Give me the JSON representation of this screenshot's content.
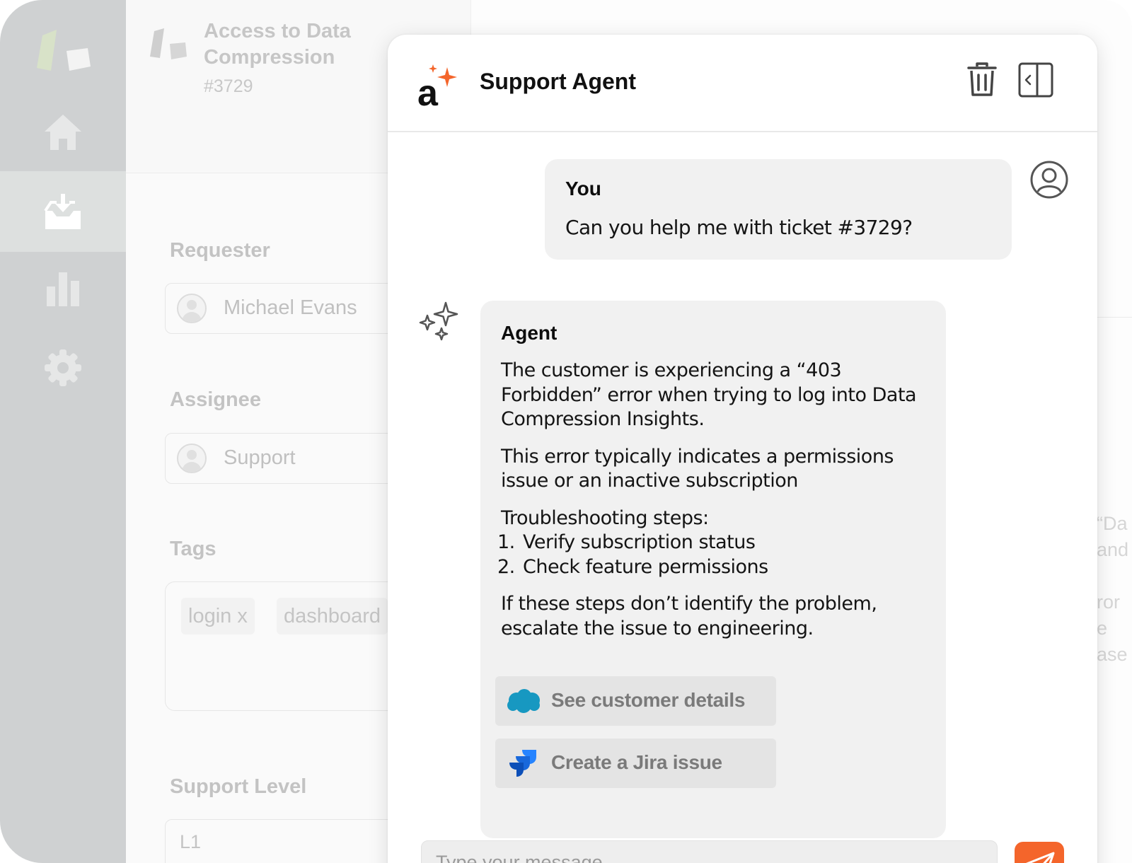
{
  "ticket": {
    "title": "Access to Data Compression Insights",
    "id": "#3729",
    "requester_label": "Requester",
    "requester": "Michael Evans",
    "assignee_label": "Assignee",
    "assignee": "Support",
    "tags_label": "Tags",
    "tags": [
      "login x",
      "dashboard"
    ],
    "support_level_label": "Support Level",
    "support_level": "L1",
    "side_fragments": [
      "“Da",
      "and",
      "ror",
      "e",
      "ase"
    ]
  },
  "sidebar": {
    "items": [
      {
        "name": "home",
        "icon": "home-icon"
      },
      {
        "name": "inbox",
        "icon": "inbox-icon",
        "active": true
      },
      {
        "name": "reports",
        "icon": "bar-chart-icon"
      },
      {
        "name": "settings",
        "icon": "gear-icon"
      }
    ]
  },
  "chat": {
    "title": "Support Agent",
    "user_name": "You",
    "user_message": "Can you help me with ticket #3729?",
    "agent_name": "Agent",
    "agent_paragraph_1": "The customer is experiencing a “403 Forbidden” error when trying to log into Data Compression Insights.",
    "agent_paragraph_2": "This error typically indicates a permissions issue or an inactive subscription",
    "steps_title": "Troubleshooting steps:",
    "steps": [
      "Verify subscription status",
      "Check feature permissions"
    ],
    "step_numbers": [
      "1.",
      "2."
    ],
    "agent_paragraph_3": "If these steps don’t identify the problem, escalate the issue to engineering.",
    "actions": {
      "customer_details": "See customer details",
      "jira_issue": "Create a Jira issue"
    },
    "composer_placeholder": "Type your message",
    "icons": [
      "trash-icon",
      "collapse-panel-icon",
      "user-avatar-icon",
      "sparkles-icon",
      "salesforce-icon",
      "jira-icon",
      "send-icon"
    ]
  },
  "colors": {
    "brand_accent": "#f4652b",
    "salesforce_blue": "#1798c1",
    "jira_blue": "#2684ff",
    "sidebar_bg": "#cfd1d2"
  }
}
